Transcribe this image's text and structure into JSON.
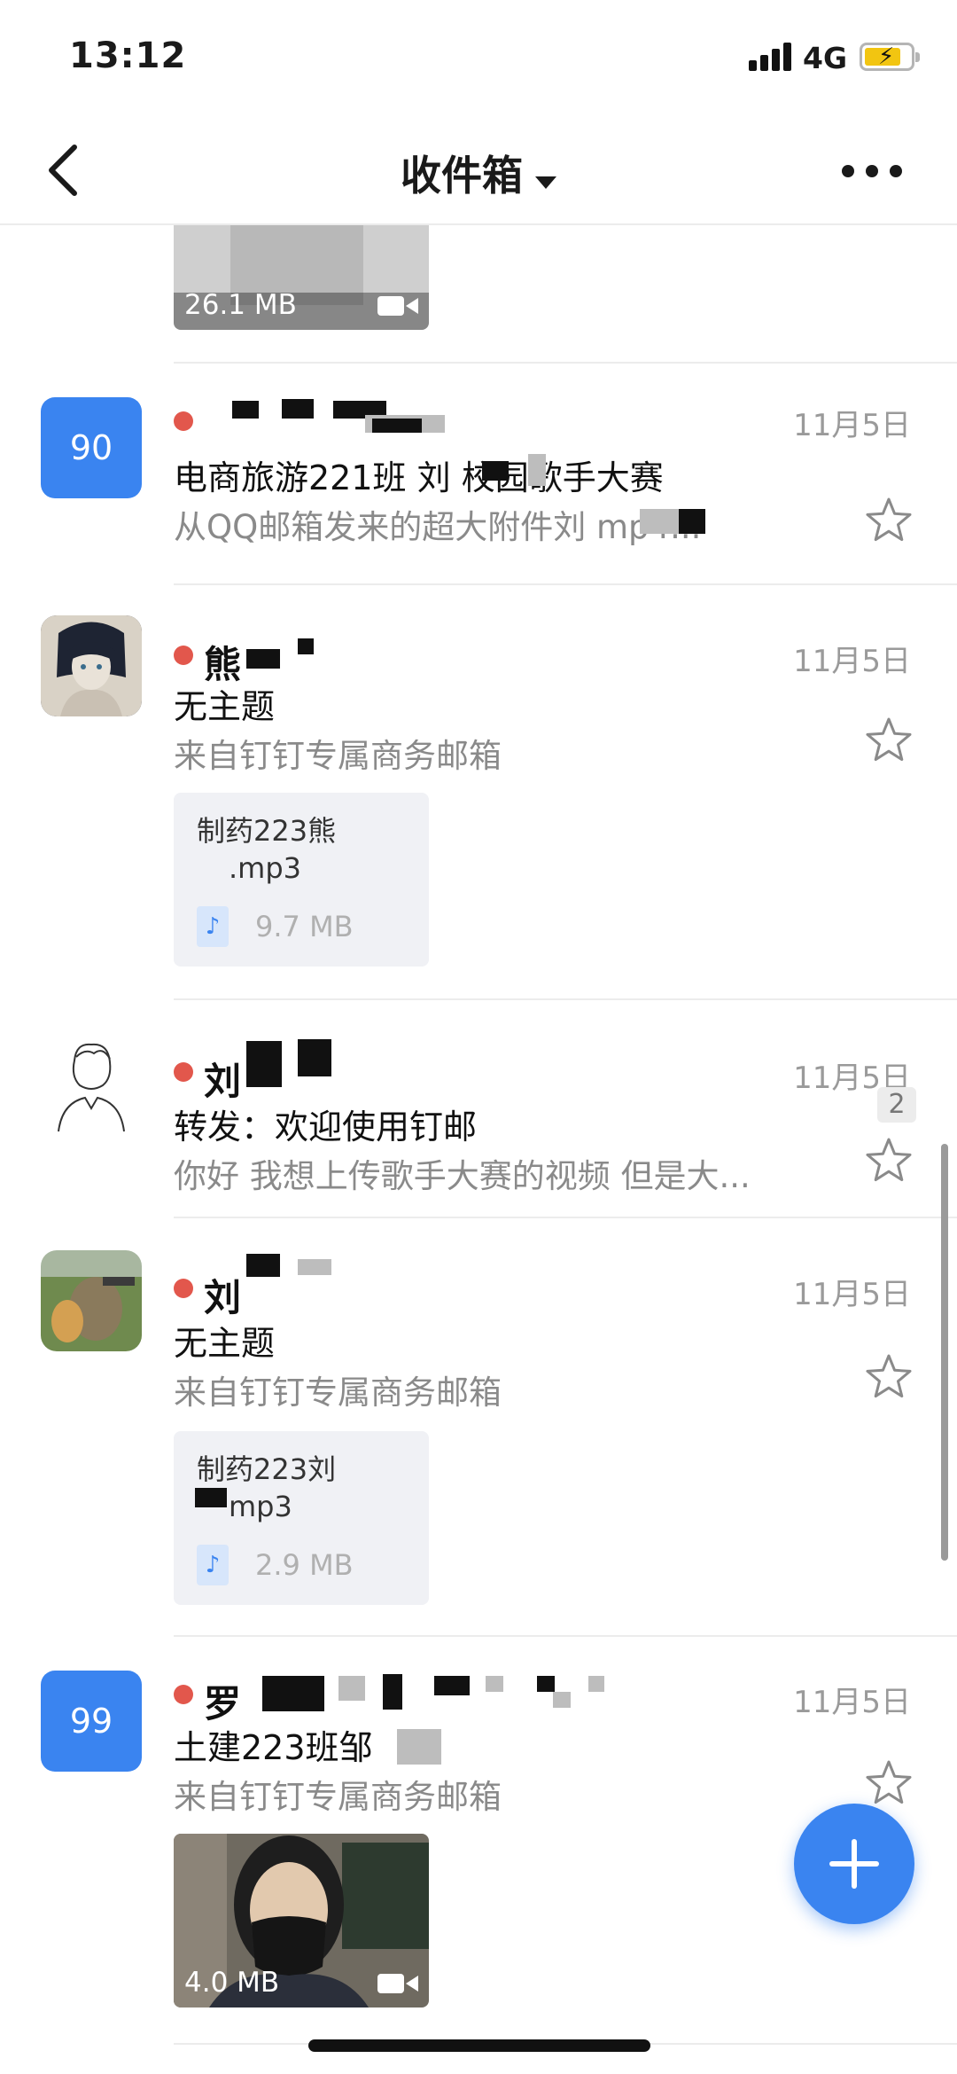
{
  "status_bar": {
    "time": "13:12",
    "network": "4G"
  },
  "nav": {
    "title": "收件箱"
  },
  "mails": [
    {
      "id": "partial",
      "attachment": {
        "type": "video",
        "size": "26.1 MB"
      }
    },
    {
      "avatar_text": "90",
      "sender": "",
      "date": "11月5日",
      "subject": "电商旅游221班   刘       校园歌手大赛",
      "preview": "从QQ邮箱发来的超大附件刘          mp4..."
    },
    {
      "sender": "熊",
      "date": "11月5日",
      "subject": "无主题",
      "preview": "来自钉钉专属商务邮箱",
      "attachment": {
        "type": "audio",
        "name_line1": "制药223熊",
        "name_line2": ".mp3",
        "size": "9.7 MB"
      }
    },
    {
      "sender": "刘",
      "date": "11月5日",
      "subject": "转发：欢迎使用钉邮",
      "preview": "你好 我想上传歌手大赛的视频 但是大...",
      "count": "2"
    },
    {
      "sender": "刘",
      "date": "11月5日",
      "subject": "无主题",
      "preview": "来自钉钉专属商务邮箱",
      "attachment": {
        "type": "audio",
        "name_line1": "制药223刘",
        "name_line2": "mp3",
        "size": "2.9 MB"
      }
    },
    {
      "avatar_text": "99",
      "sender": "罗",
      "date": "11月5日",
      "subject": "土建223班邹",
      "preview": "来自钉钉专属商务邮箱",
      "attachment": {
        "type": "video",
        "size": "4.0 MB"
      }
    }
  ],
  "colors": {
    "accent": "#3a84f0",
    "unread": "#e2574c"
  }
}
